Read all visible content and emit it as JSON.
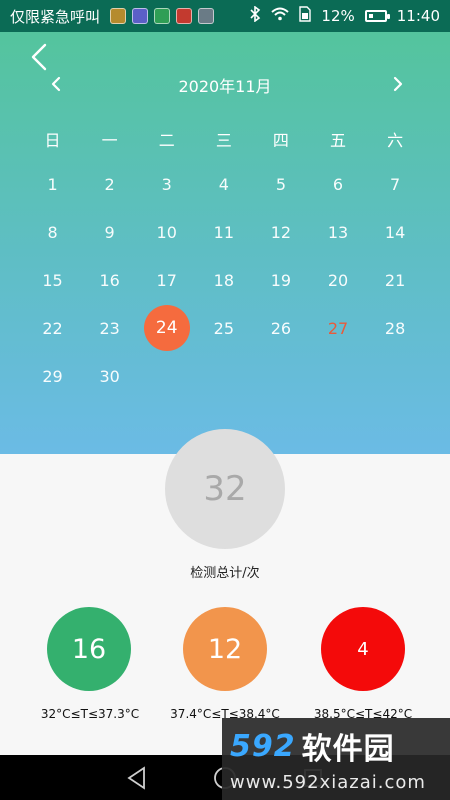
{
  "status": {
    "carrier_text": "仅限紧急呼叫",
    "battery_percent": "12%",
    "time": "11:40",
    "app_icons": [
      "app-icon-1",
      "app-icon-2",
      "app-icon-3",
      "app-icon-4",
      "app-icon-5"
    ]
  },
  "calendar": {
    "month_title": "2020年11月",
    "weekdays": [
      "日",
      "一",
      "二",
      "三",
      "四",
      "五",
      "六"
    ],
    "days": [
      "1",
      "2",
      "3",
      "4",
      "5",
      "6",
      "7",
      "8",
      "9",
      "10",
      "11",
      "12",
      "13",
      "14",
      "15",
      "16",
      "17",
      "18",
      "19",
      "20",
      "21",
      "22",
      "23",
      "24",
      "25",
      "26",
      "27",
      "28",
      "29",
      "30"
    ],
    "selected_day": "24",
    "highlighted_day": "27"
  },
  "stats": {
    "total_value": "32",
    "total_label": "检测总计/次",
    "items": [
      {
        "value": "16",
        "label": "32°C≤T≤37.3°C",
        "color": "#34b06e"
      },
      {
        "value": "12",
        "label": "37.4°C≤T≤38.4°C",
        "color": "#f2954c"
      },
      {
        "value": "4",
        "label": "38.5°C≤T≤42°C",
        "color": "#f40a0a"
      }
    ]
  },
  "watermark": {
    "brand_num": "592",
    "brand_text": "软件园",
    "url": "www.592xiazai.com"
  },
  "colors": {
    "selected_day_bg": "#f56b3e",
    "weekend_text": "#e85b3b"
  }
}
